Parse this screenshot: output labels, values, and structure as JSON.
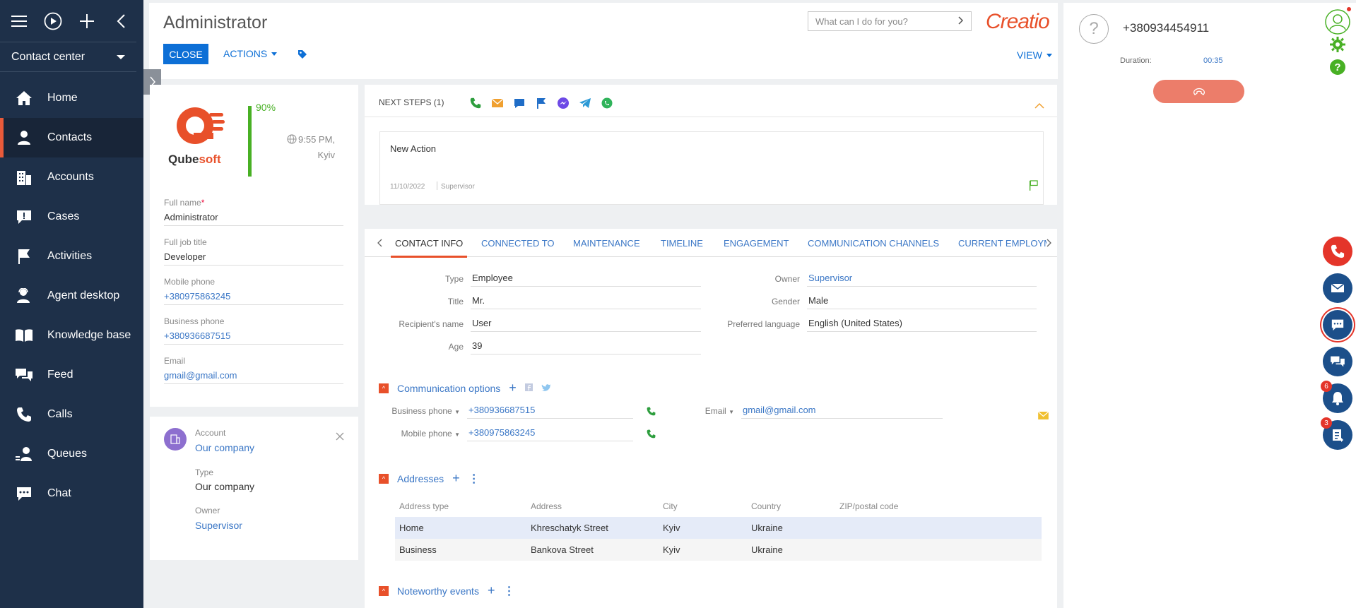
{
  "sidebar": {
    "workspace": "Contact center",
    "items": [
      {
        "label": "Home",
        "icon": "home-icon"
      },
      {
        "label": "Contacts",
        "icon": "contact-icon",
        "active": true
      },
      {
        "label": "Accounts",
        "icon": "building-icon"
      },
      {
        "label": "Cases",
        "icon": "case-icon"
      },
      {
        "label": "Activities",
        "icon": "flag-icon"
      },
      {
        "label": "Agent desktop",
        "icon": "agent-icon"
      },
      {
        "label": "Knowledge base",
        "icon": "book-icon"
      },
      {
        "label": "Feed",
        "icon": "feed-icon"
      },
      {
        "label": "Calls",
        "icon": "phone-icon"
      },
      {
        "label": "Queues",
        "icon": "queue-icon"
      },
      {
        "label": "Chat",
        "icon": "chat-icon"
      }
    ]
  },
  "header": {
    "title": "Administrator",
    "close_label": "CLOSE",
    "actions_label": "ACTIONS",
    "search_placeholder": "What can I do for you?",
    "brand": "Creatio",
    "view_label": "VIEW"
  },
  "profile": {
    "completeness": "90%",
    "local_time": "9:55 PM,",
    "local_city": "Kyiv",
    "logo_text_a": "Qube",
    "logo_text_b": "soft",
    "fields": [
      {
        "label": "Full name",
        "value": "Administrator",
        "required": true
      },
      {
        "label": "Full job title",
        "value": "Developer"
      },
      {
        "label": "Mobile phone",
        "value": "+380975863245",
        "link": true
      },
      {
        "label": "Business phone",
        "value": "+380936687515",
        "link": true
      },
      {
        "label": "Email",
        "value": "gmail@gmail.com",
        "link": true
      }
    ]
  },
  "account_card": {
    "account_label": "Account",
    "account_value": "Our company",
    "type_label": "Type",
    "type_value": "Our company",
    "owner_label": "Owner",
    "owner_value": "Supervisor"
  },
  "next_steps": {
    "title": "NEXT STEPS (1)",
    "item_title": "New Action",
    "item_date": "11/10/2022",
    "item_owner": "Supervisor"
  },
  "tabs": [
    "CONTACT INFO",
    "CONNECTED TO",
    "MAINTENANCE",
    "TIMELINE",
    "ENGAGEMENT",
    "COMMUNICATION CHANNELS",
    "CURRENT EMPLOYM"
  ],
  "contact_info": {
    "left": [
      {
        "label": "Type",
        "value": "Employee"
      },
      {
        "label": "Title",
        "value": "Mr."
      },
      {
        "label": "Recipient's name",
        "value": "User"
      },
      {
        "label": "Age",
        "value": "39"
      }
    ],
    "right": [
      {
        "label": "Owner",
        "value": "Supervisor",
        "link": true
      },
      {
        "label": "Gender",
        "value": "Male"
      },
      {
        "label": "Preferred language",
        "value": "English (United States)"
      }
    ]
  },
  "communication": {
    "title": "Communication options",
    "business_label": "Business phone",
    "business_value": "+380936687515",
    "mobile_label": "Mobile phone",
    "mobile_value": "+380975863245",
    "email_label": "Email",
    "email_value": "gmail@gmail.com"
  },
  "addresses": {
    "title": "Addresses",
    "columns": [
      "Address type",
      "Address",
      "City",
      "Country",
      "ZIP/postal code"
    ],
    "rows": [
      [
        "Home",
        "Khreschatyk Street",
        "Kyiv",
        "Ukraine",
        ""
      ],
      [
        "Business",
        "Bankova Street",
        "Kyiv",
        "Ukraine",
        ""
      ]
    ]
  },
  "noteworthy": {
    "title": "Noteworthy events"
  },
  "call_panel": {
    "phone": "+380934454911",
    "duration_label": "Duration:",
    "duration_value": "00:35",
    "notifications_count": "6",
    "tasks_count": "3"
  },
  "colors": {
    "sidebar_bg": "#1e3049",
    "accent": "#e8502a",
    "link": "#3b77c6",
    "primary_button": "#0d6fd6",
    "success": "#48b024"
  }
}
